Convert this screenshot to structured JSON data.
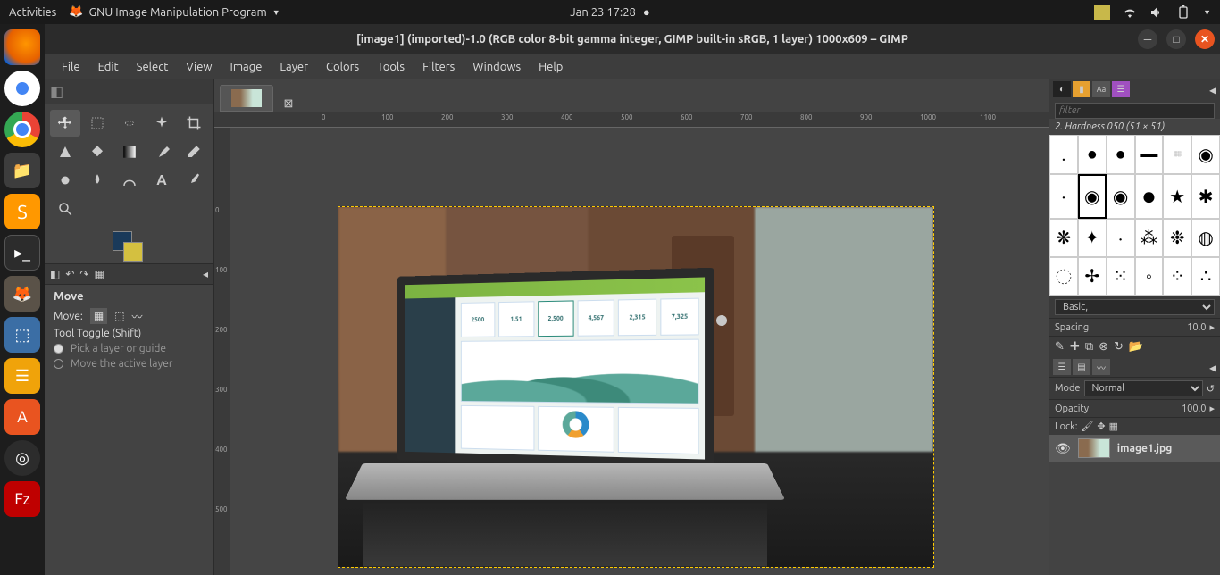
{
  "topbar": {
    "activities": "Activities",
    "app_name": "GNU Image Manipulation Program",
    "datetime": "Jan 23  17:28"
  },
  "window": {
    "title": "[image1] (imported)-1.0 (RGB color 8-bit gamma integer, GIMP built-in sRGB, 1 layer) 1000x609 – GIMP"
  },
  "menus": [
    "File",
    "Edit",
    "Select",
    "View",
    "Image",
    "Layer",
    "Colors",
    "Tools",
    "Filters",
    "Windows",
    "Help"
  ],
  "tool_options": {
    "title": "Move",
    "move_label": "Move:",
    "toggle_label": "Tool Toggle  (Shift)",
    "opt1": "Pick a layer or guide",
    "opt2": "Move the active layer"
  },
  "brushes": {
    "filter_placeholder": "filter",
    "current": "2. Hardness 050 (51 × 51)",
    "preset_label": "Basic,",
    "spacing_label": "Spacing",
    "spacing_value": "10.0"
  },
  "layers": {
    "mode_label": "Mode",
    "mode_value": "Normal",
    "opacity_label": "Opacity",
    "opacity_value": "100.0",
    "lock_label": "Lock:",
    "items": [
      {
        "name": "image1.jpg"
      }
    ]
  },
  "ruler_h": [
    "0",
    "100",
    "200",
    "300",
    "400",
    "500",
    "600",
    "700",
    "800",
    "900",
    "1000",
    "1100"
  ],
  "ruler_v": [
    "0",
    "100",
    "200",
    "300",
    "400",
    "500"
  ],
  "dashboard_metrics": [
    "2500",
    "1.51",
    "2,500",
    "4,567",
    "2,315",
    "7,325"
  ]
}
